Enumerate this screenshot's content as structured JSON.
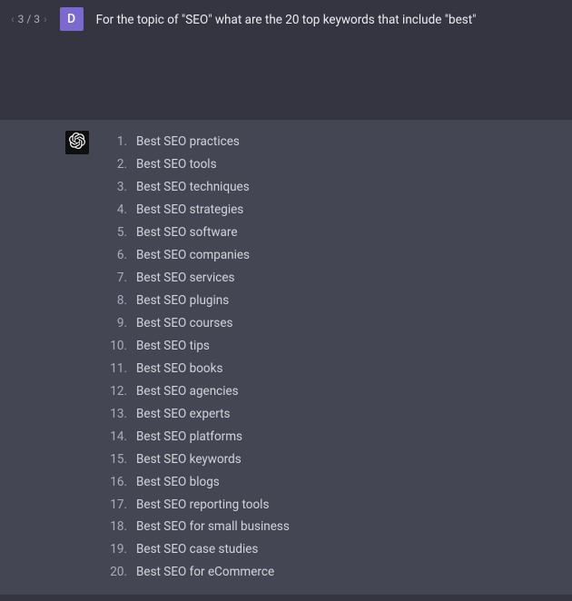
{
  "user": {
    "pager": {
      "prev": "‹",
      "label": "3 / 3",
      "next": "›"
    },
    "avatar_initial": "D",
    "message": "For the topic of  \"SEO\" what are the 20 top keywords that include \"best\""
  },
  "assistant": {
    "keywords": [
      "Best SEO practices",
      "Best SEO tools",
      "Best SEO techniques",
      "Best SEO strategies",
      "Best SEO software",
      "Best SEO companies",
      "Best SEO services",
      "Best SEO plugins",
      "Best SEO courses",
      "Best SEO tips",
      "Best SEO books",
      "Best SEO agencies",
      "Best SEO experts",
      "Best SEO platforms",
      "Best SEO keywords",
      "Best SEO blogs",
      "Best SEO reporting tools",
      "Best SEO for small business",
      "Best SEO case studies",
      "Best SEO for eCommerce"
    ]
  }
}
